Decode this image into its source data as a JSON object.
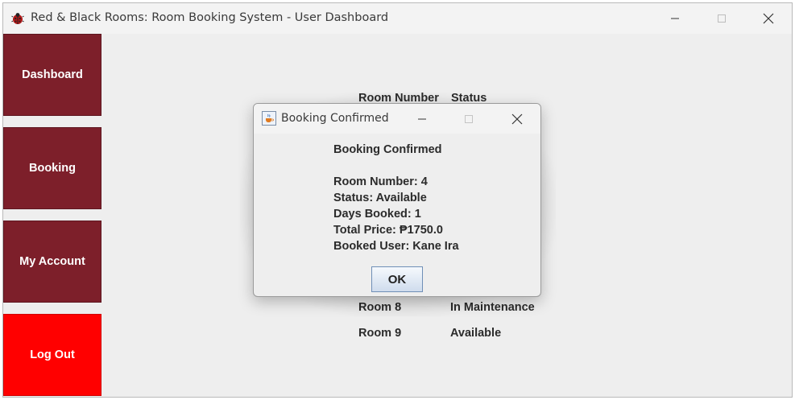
{
  "window": {
    "title": "Red & Black Rooms: Room Booking System - User Dashboard"
  },
  "sidebar": {
    "items": [
      {
        "label": "Dashboard"
      },
      {
        "label": "Booking"
      },
      {
        "label": "My Account"
      },
      {
        "label": "Log Out"
      }
    ]
  },
  "table": {
    "headers": [
      "Room Number",
      "Status"
    ],
    "rows": [
      {
        "room": "Room 8",
        "status": "In Maintenance"
      },
      {
        "room": "Room 9",
        "status": "Available"
      }
    ]
  },
  "dialog": {
    "title": "Booking Confirmed",
    "heading": "Booking Confirmed",
    "lines": [
      "Room Number: 4",
      "Status: Available",
      "Days Booked: 1",
      "Total Price: ₱1750.0",
      "Booked User: Kane Ira"
    ],
    "ok_label": "OK"
  },
  "colors": {
    "sidebar_button": "#7d1f2a",
    "logout_button": "#ff0000"
  }
}
